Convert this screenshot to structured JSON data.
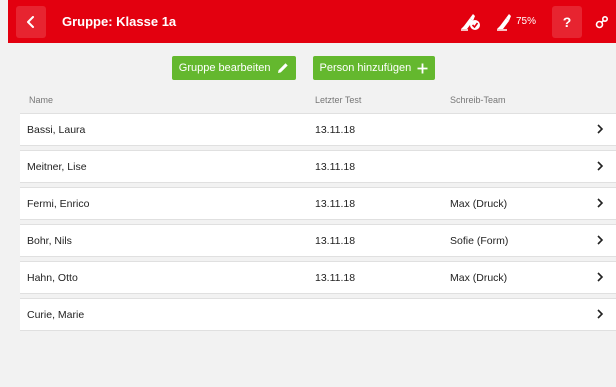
{
  "header": {
    "title": "Gruppe: Klasse 1a",
    "percent": "75%"
  },
  "actions": {
    "edit_group": "Gruppe bearbeiten",
    "add_person": "Person hinzufügen"
  },
  "columns": {
    "name": "Name",
    "last_test": "Letzter Test",
    "team": "Schreib-Team"
  },
  "rows": [
    {
      "name": "Bassi, Laura",
      "date": "13.11.18",
      "team": ""
    },
    {
      "name": "Meitner, Lise",
      "date": "13.11.18",
      "team": ""
    },
    {
      "name": "Fermi, Enrico",
      "date": "13.11.18",
      "team": "Max (Druck)"
    },
    {
      "name": "Bohr, Nils",
      "date": "13.11.18",
      "team": "Sofie (Form)"
    },
    {
      "name": "Hahn, Otto",
      "date": "13.11.18",
      "team": "Max (Druck)"
    },
    {
      "name": "Curie, Marie",
      "date": "",
      "team": ""
    }
  ],
  "colors": {
    "brand_red": "#e3000f",
    "action_green": "#64b82e",
    "background": "#f2f2f2"
  },
  "icons": {
    "back": "chevron-left-icon",
    "check_hand": "handwriting-check-icon",
    "progress_hand": "handwriting-progress-icon",
    "help": "help-icon",
    "settings": "settings-icon",
    "edit": "pencil-icon",
    "add": "plus-icon",
    "row_chevron": "chevron-right-icon"
  }
}
